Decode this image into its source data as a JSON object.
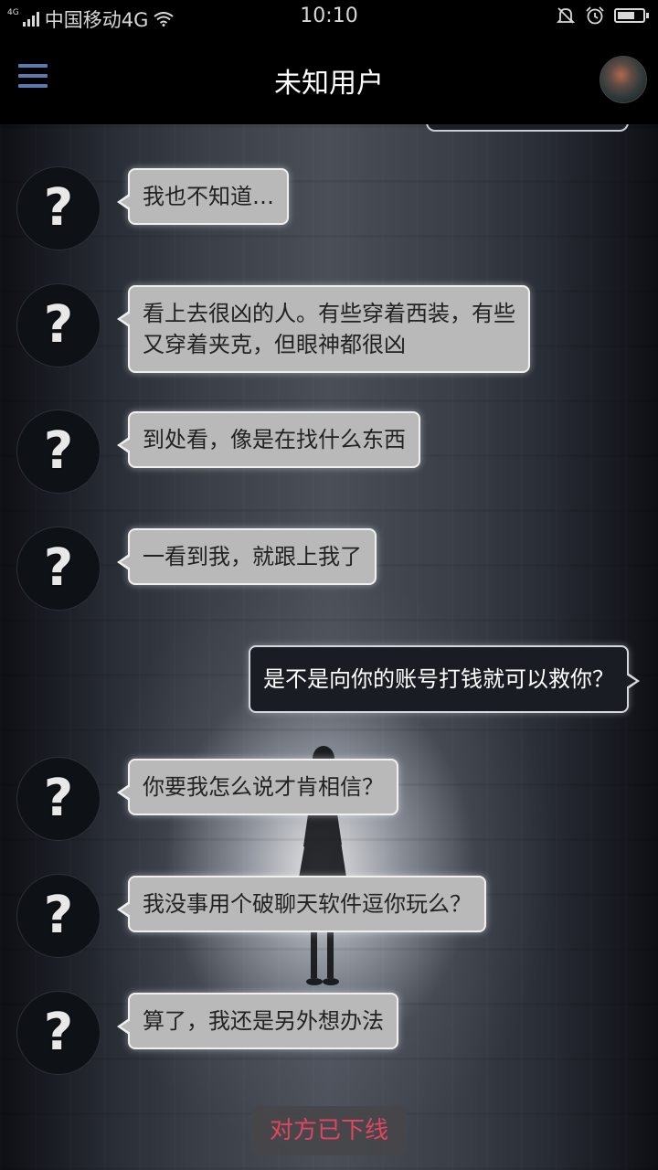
{
  "status_bar": {
    "net_small": "4G",
    "carrier": "中国移动4G",
    "time": "10:10",
    "battery_level": 0.7,
    "icons": [
      "signal-icon",
      "wifi-icon",
      "silent-bell-icon",
      "alarm-icon",
      "battery-icon"
    ]
  },
  "header": {
    "title": "未知用户",
    "menu_icon": "hamburger-menu-icon",
    "accent_color": "#5b7bb0"
  },
  "messages": [
    {
      "direction": "in",
      "avatar_glyph": "?",
      "text": "我也不知道…"
    },
    {
      "direction": "in",
      "avatar_glyph": "?",
      "lines": [
        "看上去很凶的人。有些穿着西装，有些",
        "又穿着夹克，但眼神都很凶"
      ]
    },
    {
      "direction": "in",
      "avatar_glyph": "?",
      "text": "到处看，像是在找什么东西"
    },
    {
      "direction": "in",
      "avatar_glyph": "?",
      "text": "一看到我，就跟上我了"
    },
    {
      "direction": "out",
      "text": "是不是向你的账号打钱就可以救你？"
    },
    {
      "direction": "in",
      "avatar_glyph": "?",
      "text": "你要我怎么说才肯相信？"
    },
    {
      "direction": "in",
      "avatar_glyph": "?",
      "text": "我没事用个破聊天软件逗你玩么？"
    },
    {
      "direction": "in",
      "avatar_glyph": "?",
      "text": "算了，我还是另外想办法"
    }
  ],
  "footer_status": {
    "text": "对方已下线",
    "color": "#e2455e"
  }
}
